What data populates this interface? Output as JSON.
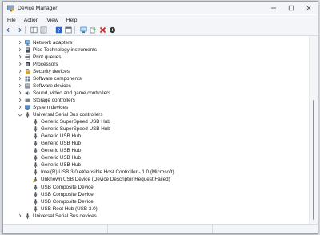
{
  "window": {
    "title": "Device Manager"
  },
  "menu": [
    "File",
    "Action",
    "View",
    "Help"
  ],
  "toolbar": [
    {
      "name": "back-icon",
      "color": "#3d6fb5"
    },
    {
      "name": "forward-icon",
      "color": "#3d6fb5"
    },
    {
      "name": "console-tree-icon",
      "color": "#5b6b7a"
    },
    {
      "name": "properties-icon",
      "color": "#5b6b7a"
    },
    {
      "name": "help-icon",
      "color": "#2f62c4"
    },
    {
      "name": "details-view-icon",
      "color": "#5b6b7a"
    },
    {
      "name": "scan-hardware-icon",
      "color": "#2f7fc4"
    },
    {
      "name": "update-driver-icon",
      "color": "#3a9a3a"
    },
    {
      "name": "uninstall-icon",
      "color": "#d02020"
    },
    {
      "name": "disable-icon",
      "color": "#333333"
    }
  ],
  "tree": [
    {
      "label": "Network adapters",
      "level": 1,
      "expander": "collapsed",
      "icon": "network-icon"
    },
    {
      "label": "Pico Technology instruments",
      "level": 1,
      "expander": "collapsed",
      "icon": "instrument-icon"
    },
    {
      "label": "Print queues",
      "level": 1,
      "expander": "collapsed",
      "icon": "printer-icon"
    },
    {
      "label": "Processors",
      "level": 1,
      "expander": "collapsed",
      "icon": "processor-icon"
    },
    {
      "label": "Security devices",
      "level": 1,
      "expander": "collapsed",
      "icon": "security-icon"
    },
    {
      "label": "Software components",
      "level": 1,
      "expander": "collapsed",
      "icon": "software-component-icon"
    },
    {
      "label": "Software devices",
      "level": 1,
      "expander": "collapsed",
      "icon": "software-device-icon"
    },
    {
      "label": "Sound, video and game controllers",
      "level": 1,
      "expander": "collapsed",
      "icon": "speaker-icon"
    },
    {
      "label": "Storage controllers",
      "level": 1,
      "expander": "collapsed",
      "icon": "storage-icon"
    },
    {
      "label": "System devices",
      "level": 1,
      "expander": "collapsed",
      "icon": "system-icon"
    },
    {
      "label": "Universal Serial Bus controllers",
      "level": 1,
      "expander": "expanded",
      "icon": "usb-icon"
    },
    {
      "label": "Generic SuperSpeed USB Hub",
      "level": 2,
      "expander": "none",
      "icon": "usb-icon"
    },
    {
      "label": "Generic SuperSpeed USB Hub",
      "level": 2,
      "expander": "none",
      "icon": "usb-icon"
    },
    {
      "label": "Generic USB Hub",
      "level": 2,
      "expander": "none",
      "icon": "usb-icon"
    },
    {
      "label": "Generic USB Hub",
      "level": 2,
      "expander": "none",
      "icon": "usb-icon"
    },
    {
      "label": "Generic USB Hub",
      "level": 2,
      "expander": "none",
      "icon": "usb-icon"
    },
    {
      "label": "Generic USB Hub",
      "level": 2,
      "expander": "none",
      "icon": "usb-icon"
    },
    {
      "label": "Generic USB Hub",
      "level": 2,
      "expander": "none",
      "icon": "usb-icon"
    },
    {
      "label": "Intel(R) USB 3.0 eXtensible Host Controller - 1.0 (Microsoft)",
      "level": 2,
      "expander": "none",
      "icon": "usb-icon"
    },
    {
      "label": "Unknown USB Device (Device Descriptor Request Failed)",
      "level": 2,
      "expander": "none",
      "icon": "warning-usb-icon"
    },
    {
      "label": "USB Composite Device",
      "level": 2,
      "expander": "none",
      "icon": "usb-icon"
    },
    {
      "label": "USB Composite Device",
      "level": 2,
      "expander": "none",
      "icon": "usb-icon"
    },
    {
      "label": "USB Composite Device",
      "level": 2,
      "expander": "none",
      "icon": "usb-icon"
    },
    {
      "label": "USB Root Hub (USB 3.0)",
      "level": 2,
      "expander": "none",
      "icon": "usb-icon"
    },
    {
      "label": "Universal Serial Bus devices",
      "level": 1,
      "expander": "collapsed",
      "icon": "usb-icon"
    }
  ]
}
